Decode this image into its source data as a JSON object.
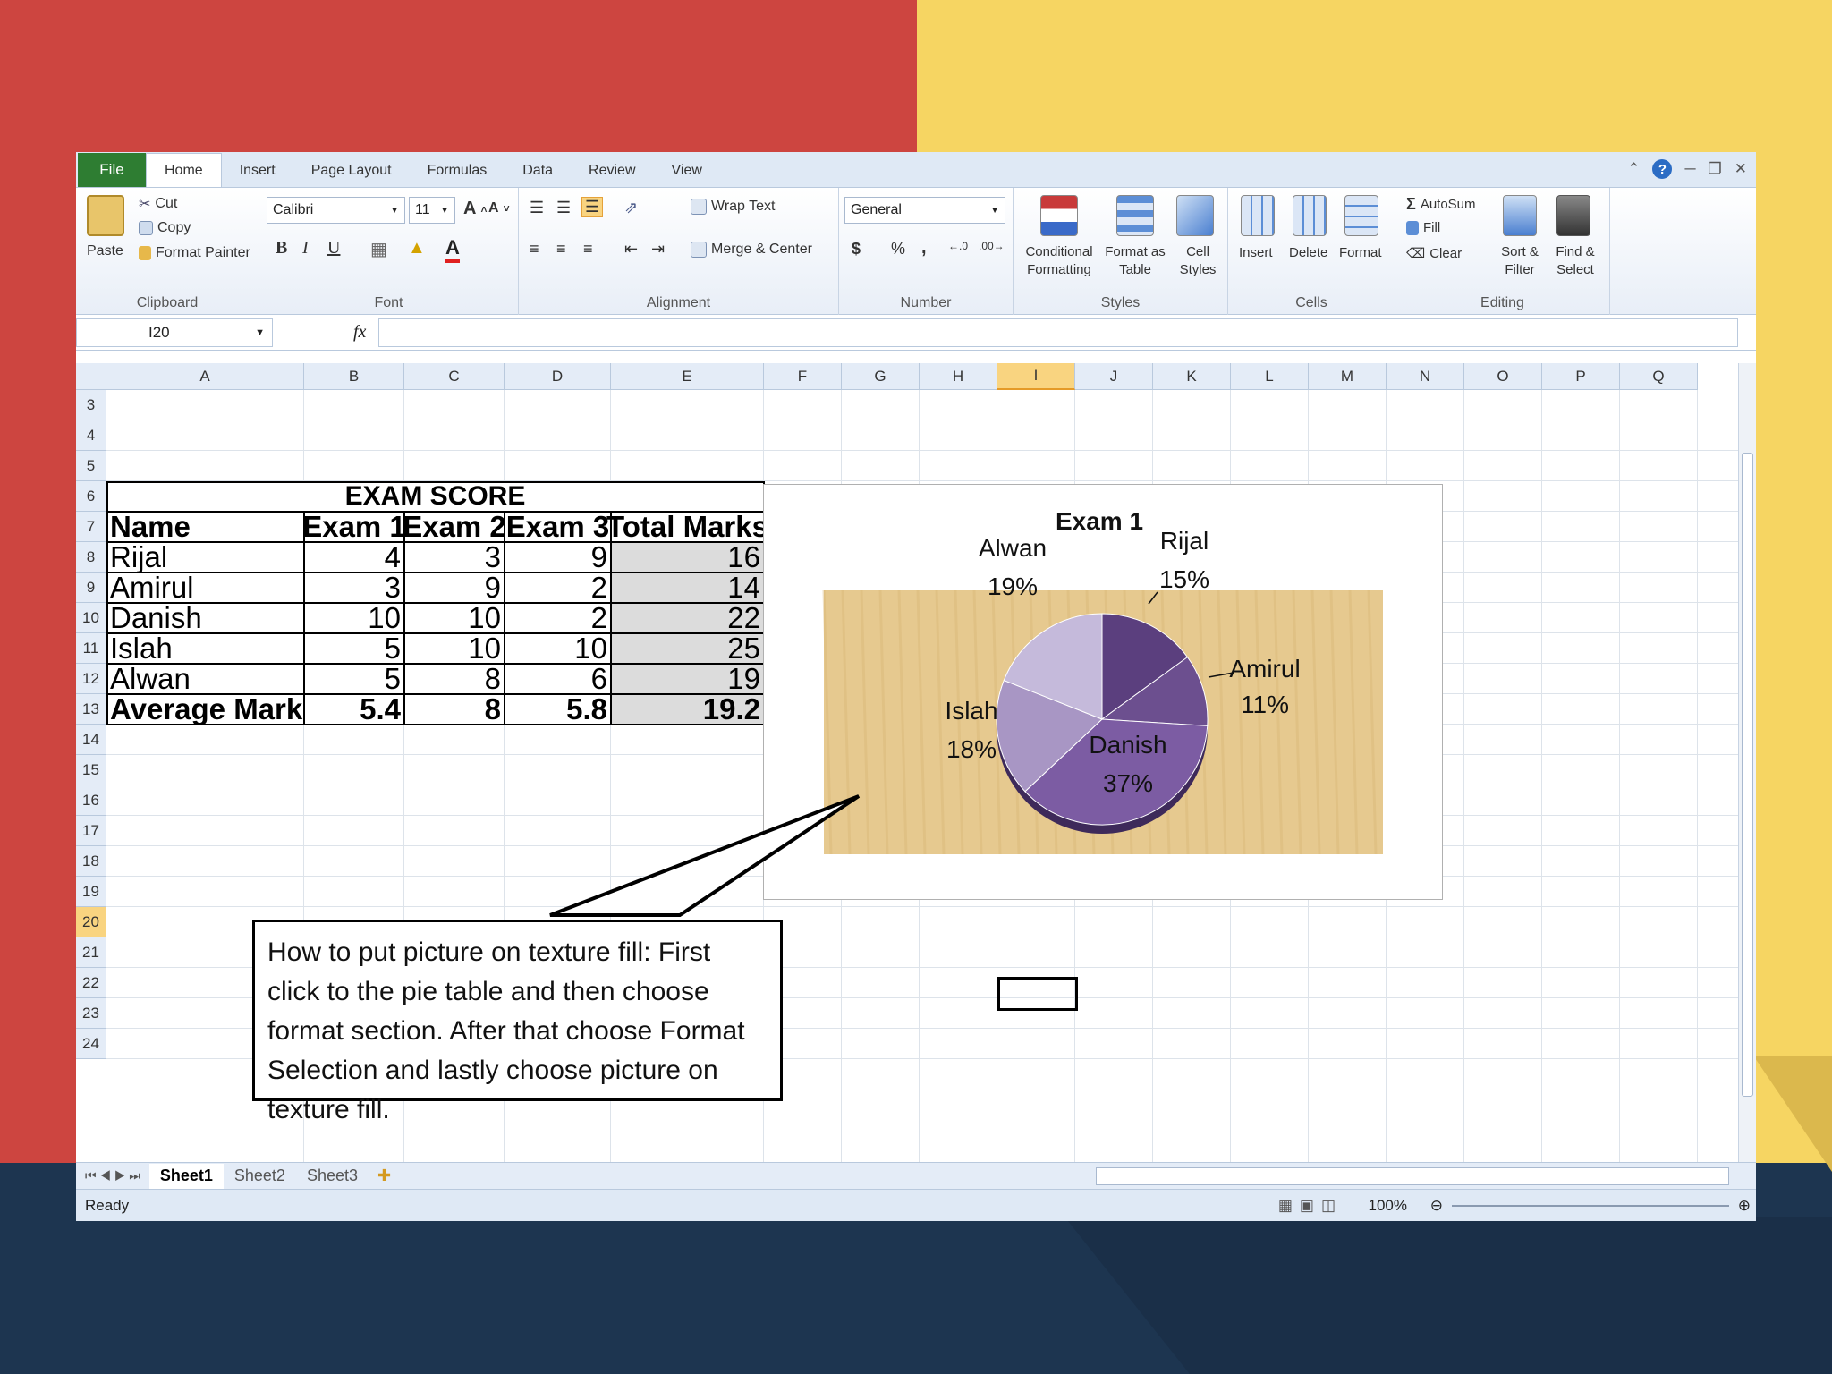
{
  "ribbon": {
    "tabs": [
      "File",
      "Home",
      "Insert",
      "Page Layout",
      "Formulas",
      "Data",
      "Review",
      "View"
    ],
    "clipboard": {
      "paste": "Paste",
      "cut": "Cut",
      "copy": "Copy",
      "format_painter": "Format Painter",
      "label": "Clipboard"
    },
    "font": {
      "name": "Calibri",
      "size": "11",
      "label": "Font",
      "bold": "B",
      "italic": "I",
      "underline": "U"
    },
    "alignment": {
      "wrap_text": "Wrap Text",
      "merge_center": "Merge & Center",
      "label": "Alignment"
    },
    "number": {
      "format": "General",
      "currency": "$",
      "percent": "%",
      "comma": ",",
      "label": "Number"
    },
    "styles": {
      "conditional": "Conditional Formatting",
      "format_table": "Format as Table",
      "cell_styles": "Cell Styles",
      "label": "Styles"
    },
    "cells": {
      "insert": "Insert",
      "delete": "Delete",
      "format": "Format",
      "label": "Cells"
    },
    "editing": {
      "autosum": "AutoSum",
      "fill": "Fill",
      "clear": "Clear",
      "sort_filter": "Sort & Filter",
      "find_select": "Find & Select",
      "label": "Editing"
    }
  },
  "formula_bar": {
    "name_box": "I20",
    "fx": "fx",
    "content": ""
  },
  "columns": [
    "A",
    "B",
    "C",
    "D",
    "E",
    "F",
    "G",
    "H",
    "I",
    "J",
    "K",
    "L",
    "M",
    "N",
    "O",
    "P",
    "Q"
  ],
  "rows": [
    "3",
    "4",
    "5",
    "6",
    "7",
    "8",
    "9",
    "10",
    "11",
    "12",
    "13",
    "14",
    "15",
    "16",
    "17",
    "18",
    "19",
    "20",
    "21",
    "22",
    "23",
    "24"
  ],
  "table": {
    "title": "EXAM SCORE",
    "headers": [
      "Name",
      "Exam 1",
      "Exam 2",
      "Exam 3",
      "Total Marks"
    ],
    "rows": [
      [
        "Rijal",
        "4",
        "3",
        "9",
        "16"
      ],
      [
        "Amirul",
        "3",
        "9",
        "2",
        "14"
      ],
      [
        "Danish",
        "10",
        "10",
        "2",
        "22"
      ],
      [
        "Islah",
        "5",
        "10",
        "10",
        "25"
      ],
      [
        "Alwan",
        "5",
        "8",
        "6",
        "19"
      ],
      [
        "Average Marks",
        "5.4",
        "8",
        "5.8",
        "19.2"
      ]
    ]
  },
  "chart_data": {
    "type": "pie",
    "title": "Exam 1",
    "categories": [
      "Rijal",
      "Amirul",
      "Danish",
      "Islah",
      "Alwan"
    ],
    "values": [
      15,
      11,
      37,
      18,
      19
    ],
    "labels": [
      "15%",
      "11%",
      "37%",
      "18%",
      "19%"
    ],
    "colors": [
      "#5b3f7e",
      "#6c4f8f",
      "#7c5ca3",
      "#a896c4",
      "#c5badb"
    ],
    "background": "#e6c98f"
  },
  "callout": "How to put picture on texture fill: First click to the pie table and then choose format section. After that choose Format Selection and lastly choose picture on texture fill.",
  "sheets": [
    "Sheet1",
    "Sheet2",
    "Sheet3"
  ],
  "status": {
    "ready": "Ready",
    "zoom": "100%"
  }
}
